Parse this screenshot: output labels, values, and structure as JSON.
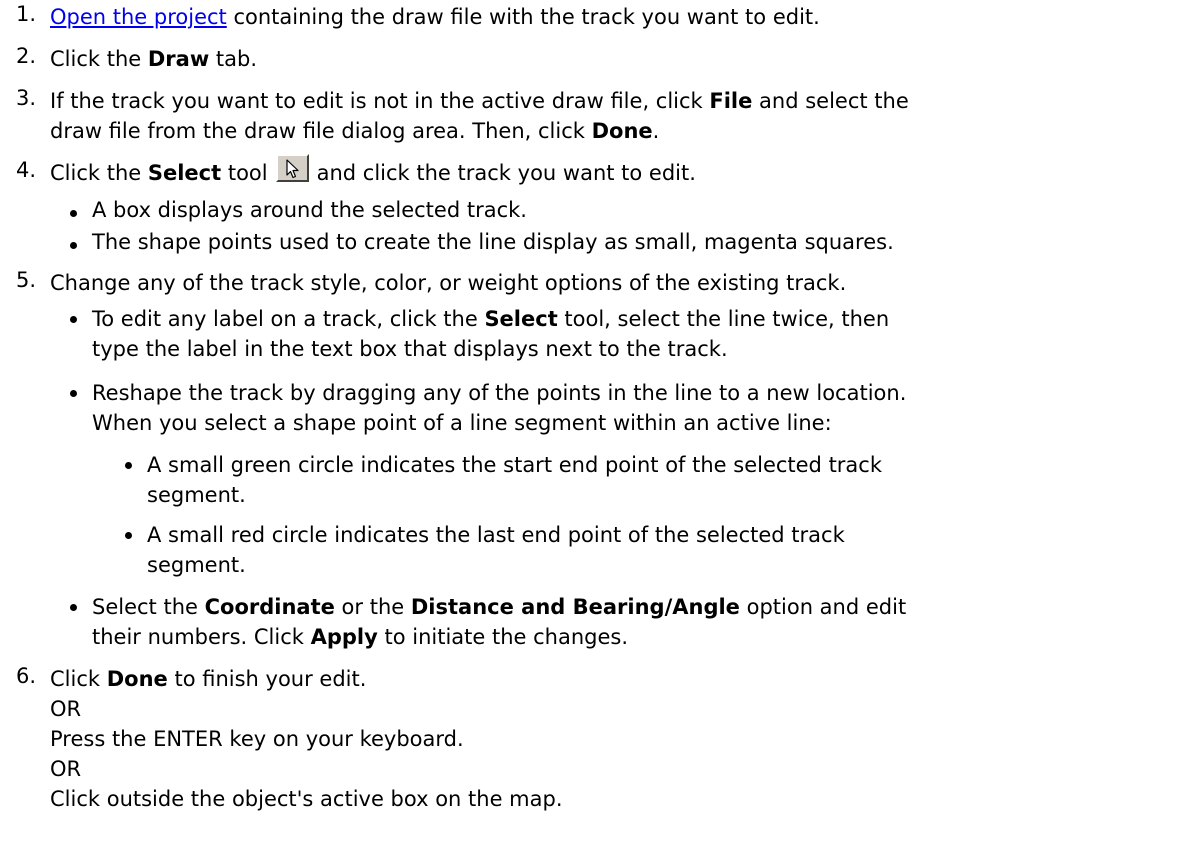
{
  "steps": [
    {
      "number": "1.",
      "link": "Open the project",
      "text": " containing the draw file with the track you want to edit."
    },
    {
      "number": "2.",
      "pre": "Click the ",
      "bold": "Draw",
      "post": " tab."
    },
    {
      "number": "3.",
      "pre": "If the track you want to edit is not in the active draw file, click ",
      "bold1": "File",
      "mid": " and select the",
      "line2_pre": "draw file from the draw file dialog area. Then, click ",
      "bold2": "Done",
      "line2_post": "."
    },
    {
      "number": "4.",
      "pre": "Click the ",
      "bold": "Select",
      "mid": " tool",
      "post": "and click the track you want to edit.",
      "tool_icon": "select-arrow-icon",
      "bullets": [
        "A box displays around the selected track.",
        "The shape points used to create the line display as small, magenta squares."
      ]
    },
    {
      "number": "5.",
      "text": "Change any of the track style, color, or weight options of the existing track.",
      "bullet1": {
        "pre": "To edit any label on a track, click the ",
        "bold": "Select",
        "post": " tool, select the line twice, then",
        "line2": "type the label in the text box that displays next to the track."
      },
      "bullet2": {
        "line1": "Reshape the track by dragging any of the points in the line to a new location.",
        "line2": "When you select a shape point of a line segment within an active line:",
        "sub": [
          {
            "line1": "A small green circle indicates the start end point of the selected track",
            "line2": "segment."
          },
          {
            "line1": "A small red circle indicates the last end point of the selected track",
            "line2": "segment."
          }
        ]
      },
      "bullet3": {
        "pre": "Select the ",
        "bold1": "Coordinate",
        "mid": " or the ",
        "bold2": "Distance and Bearing/Angle",
        "post": " option and edit",
        "line2_pre": "their numbers. Click ",
        "line2_bold": "Apply",
        "line2_post": " to initiate the changes."
      }
    },
    {
      "number": "6.",
      "pre": "Click ",
      "bold": "Done",
      "post": " to finish your edit.",
      "or1": "OR",
      "alt1": "Press the ENTER key on your keyboard.",
      "or2": "OR",
      "alt2": "Click outside the object's active box on the map."
    }
  ]
}
